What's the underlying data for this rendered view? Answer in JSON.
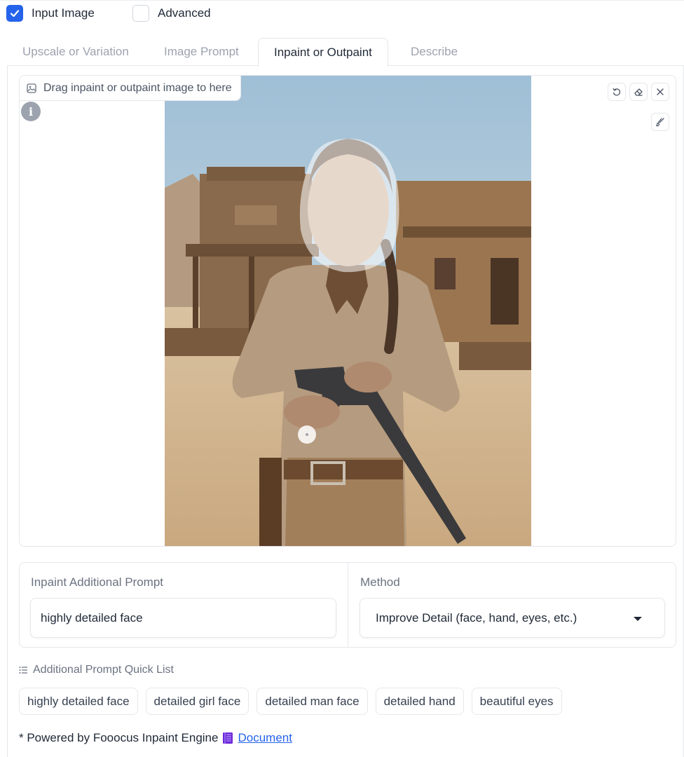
{
  "checkboxes": {
    "input_image": {
      "label": "Input Image",
      "checked": true
    },
    "advanced": {
      "label": "Advanced",
      "checked": false
    }
  },
  "tabs": [
    {
      "label": "Upscale or Variation",
      "active": false
    },
    {
      "label": "Image Prompt",
      "active": false
    },
    {
      "label": "Inpaint or Outpaint",
      "active": true
    },
    {
      "label": "Describe",
      "active": false
    }
  ],
  "image_panel": {
    "drop_label": "Drag inpaint or outpaint image to here",
    "info_glyph": "i",
    "icons": [
      "image-icon",
      "undo-icon",
      "eraser-icon",
      "close-icon",
      "brush-icon"
    ]
  },
  "inpaint": {
    "prompt_label": "Inpaint Additional Prompt",
    "prompt_value": "highly detailed face",
    "method_label": "Method",
    "method_value": "Improve Detail (face, hand, eyes, etc.)"
  },
  "quick_list": {
    "title": "Additional Prompt Quick List",
    "items": [
      "highly detailed face",
      "detailed girl face",
      "detailed man face",
      "detailed hand",
      "beautiful eyes"
    ]
  },
  "footer": {
    "text": "* Powered by Fooocus Inpaint Engine",
    "link": "Document"
  },
  "colors": {
    "accent": "#2563eb",
    "border": "#e5e7eb",
    "muted_text": "#9ca3af"
  }
}
